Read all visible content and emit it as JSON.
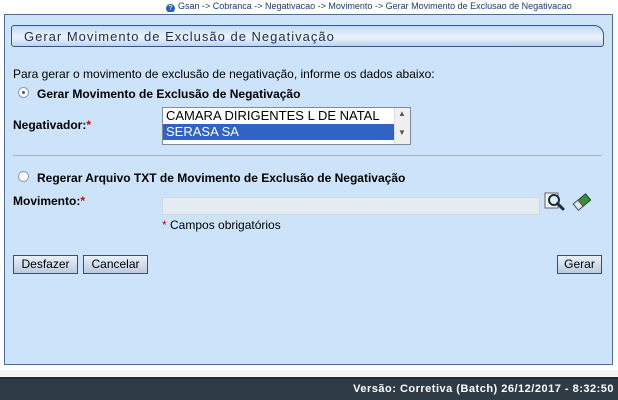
{
  "breadcrumb": {
    "text": "Gsan -> Cobranca -> Negativacao -> Movimento -> Gerar Movimento de Exclusao de Negativacao"
  },
  "form": {
    "title": "Gerar Movimento de Exclusão de Negativação",
    "intro": "Para gerar o movimento de exclusão de negativação, informe os dados abaixo:",
    "option_generate_label": "Gerar Movimento de Exclusão de Negativação",
    "option_regenerate_label": "Regerar Arquivo TXT de Movimento de Exclusão de Negativação",
    "negativador_label": "Negativador:",
    "negativador_options": [
      "CAMARA DIRIGENTES L DE NATAL",
      "SERASA SA"
    ],
    "negativador_selected": "SERASA SA",
    "movimento_label": "Movimento:",
    "movimento_value": "",
    "required_asterisk": "*",
    "required_note": "Campos obrigatórios"
  },
  "buttons": {
    "undo": "Desfazer",
    "cancel": "Cancelar",
    "generate": "Gerar"
  },
  "footer": {
    "version": "Versão: Corretiva (Batch) 26/12/2017 - 8:32:50"
  },
  "icons": {
    "search": "magnifier-icon",
    "clear": "eraser-icon"
  },
  "colors": {
    "panel_bg": "#cde3fa",
    "selection": "#3163c4",
    "footer_bg": "#2f3b45",
    "required": "#cc0000"
  }
}
